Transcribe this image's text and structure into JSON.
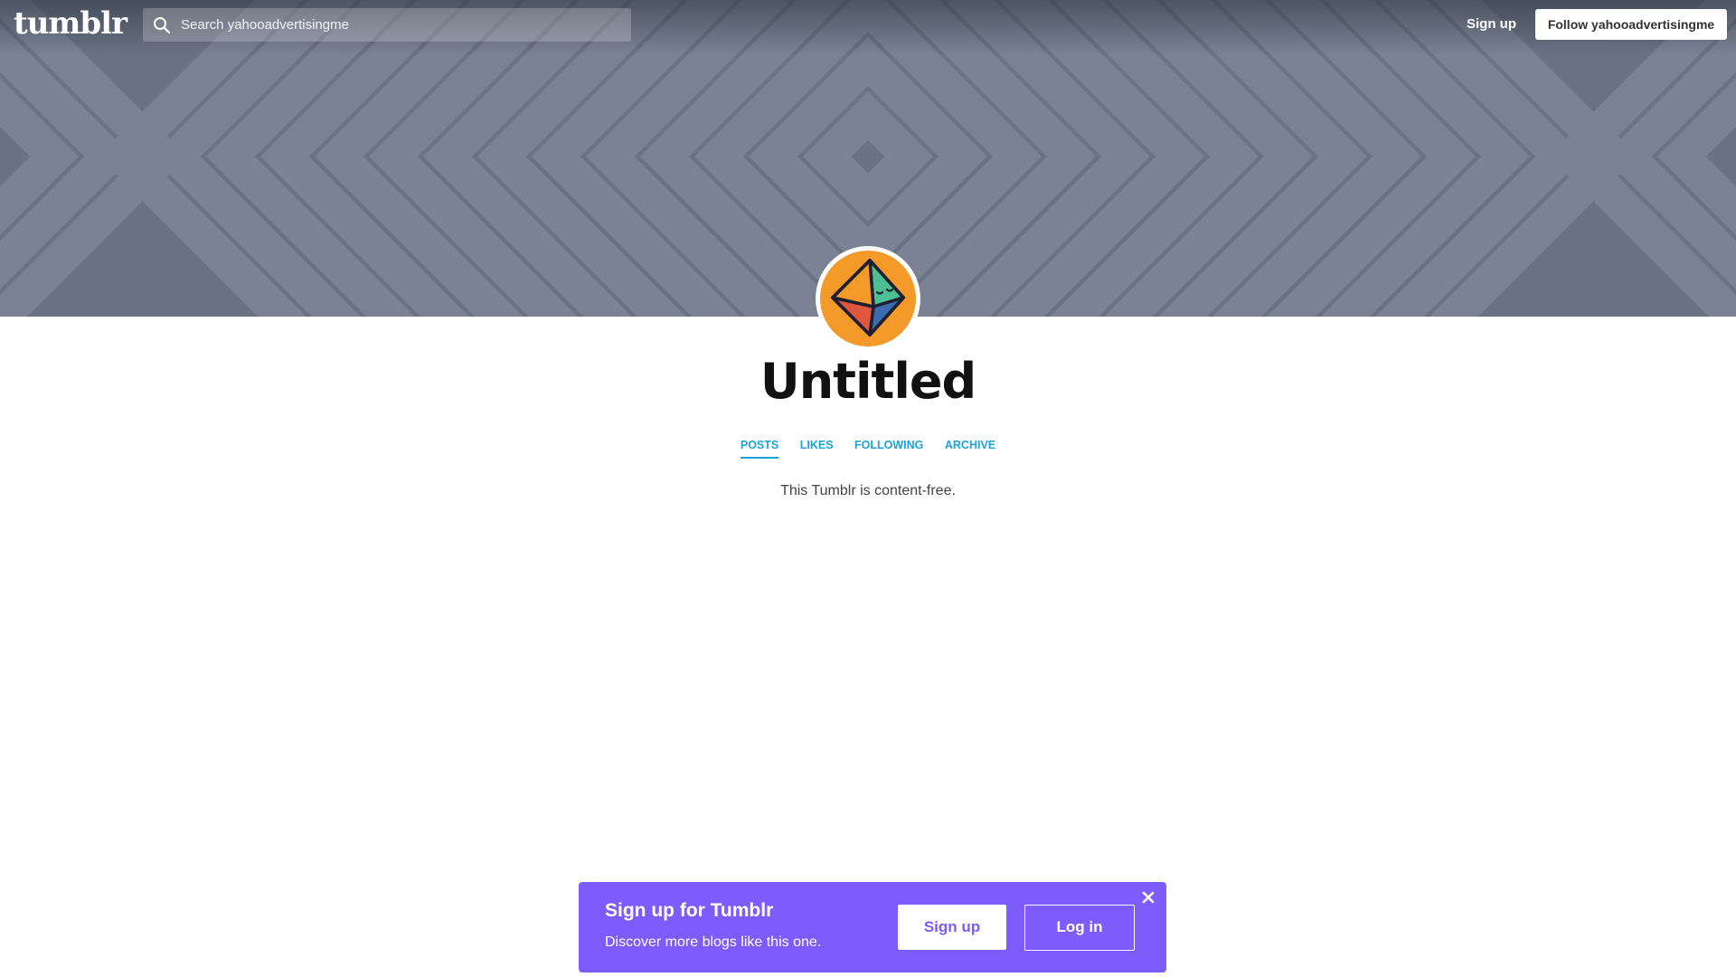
{
  "header": {
    "logo": "tumblr",
    "search": {
      "placeholder": "Search yahooadvertisingme",
      "icon": "search-icon"
    },
    "signup_label": "Sign up",
    "follow_label": "Follow yahooadvertisingme"
  },
  "blog": {
    "title": "Untitled",
    "tabs": [
      {
        "label": "POSTS",
        "active": true
      },
      {
        "label": "LIKES",
        "active": false
      },
      {
        "label": "FOLLOWING",
        "active": false
      },
      {
        "label": "ARCHIVE",
        "active": false
      }
    ],
    "empty_message": "This Tumblr is content-free."
  },
  "signup_banner": {
    "title": "Sign up for Tumblr",
    "subtitle": "Discover more blogs like this one.",
    "signup_label": "Sign up",
    "login_label": "Log in",
    "close_icon": "close-icon"
  },
  "colors": {
    "banner": "#6a7283",
    "banner_stripe": "#7a8294",
    "link_blue": "#1fa2d6",
    "signup_purple": "#7c5cff",
    "avatar_orange": "#f39a2a"
  }
}
